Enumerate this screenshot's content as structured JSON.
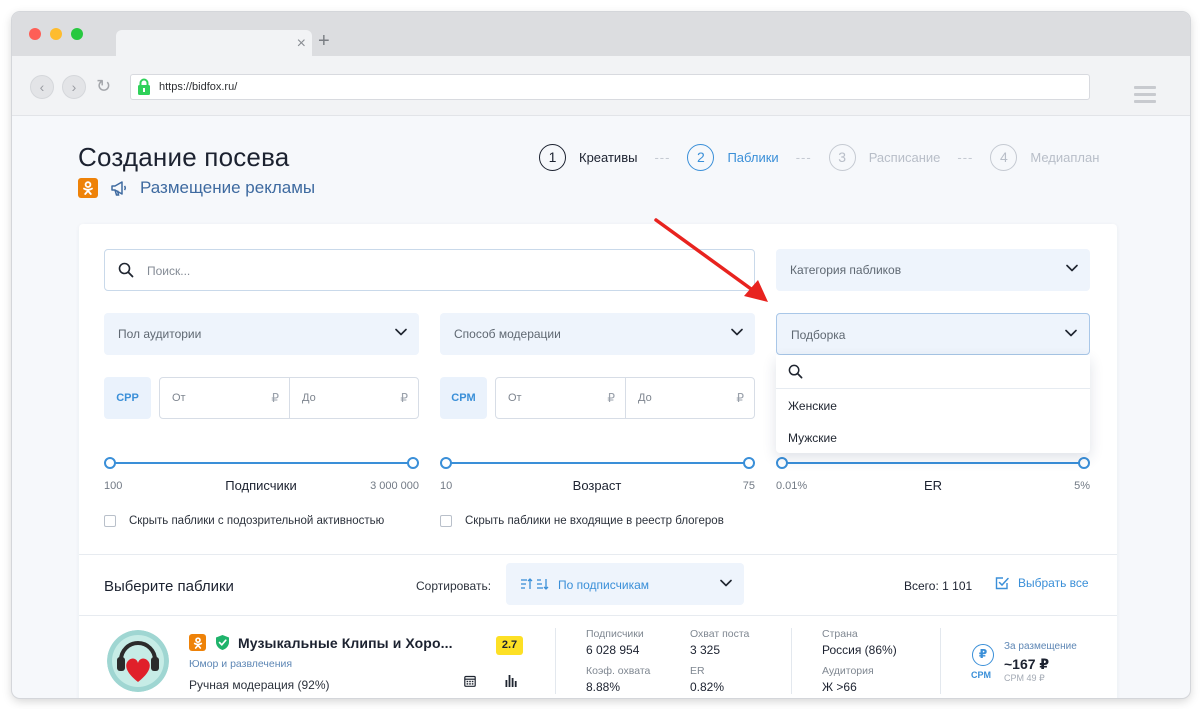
{
  "browser": {
    "url": "https://bidfox.ru/",
    "tab_close": "×",
    "new_tab": "+",
    "back": "‹",
    "forward": "›",
    "reload": "↻"
  },
  "header": {
    "title": "Создание посева",
    "subtitle": "Размещение рекламы"
  },
  "steps": [
    {
      "num": "1",
      "label": "Креативы",
      "state": "done"
    },
    {
      "num": "2",
      "label": "Паблики",
      "state": "active"
    },
    {
      "num": "3",
      "label": "Расписание",
      "state": "muted"
    },
    {
      "num": "4",
      "label": "Медиаплан",
      "state": "muted"
    }
  ],
  "step_separator": "---",
  "filters": {
    "search_placeholder": "Поиск...",
    "category": "Категория пабликов",
    "gender": "Пол аудитории",
    "moderation": "Способ модерации",
    "collection": "Подборка",
    "range1": {
      "tag": "CPP",
      "from": "От",
      "to": "До",
      "currency": "₽"
    },
    "range2": {
      "tag": "CPM",
      "from": "От",
      "to": "До",
      "currency": "₽"
    },
    "slider_subscribers": {
      "min": "100",
      "max": "3 000 000",
      "title": "Подписчики"
    },
    "slider_age": {
      "min": "10",
      "max": "75",
      "title": "Возраст"
    },
    "slider_er": {
      "min": "0.01%",
      "max": "5%",
      "title": "ER"
    },
    "check_suspicious": "Скрыть паблики с подозрительной активностью",
    "check_registry": "Скрыть паблики не входящие в реестр блогеров"
  },
  "dropdown": {
    "items": [
      "Женские",
      "Мужские"
    ]
  },
  "list": {
    "title": "Выберите паблики",
    "sort_label": "Сортировать:",
    "sort_value": "По подписчикам",
    "total": "Всего: 1 101",
    "select_all": "Выбрать все"
  },
  "publics": [
    {
      "name": "Музыкальные Клипы и Хоро...",
      "rating": "2.7",
      "category": "Юмор и развлечения",
      "moderation": "Ручная модерация (92%)",
      "subscribers_label": "Подписчики",
      "subscribers": "6 028 954",
      "reach_label": "Охват поста",
      "reach": "3 325",
      "coverage_label": "Коэф. охвата",
      "coverage": "8.88%",
      "er_label": "ER",
      "er": "0.82%",
      "country_label": "Страна",
      "country": "Россия (86%)",
      "audience_label": "Аудитория",
      "audience": "Ж >66",
      "price_label": "За размещение",
      "price": "~167 ₽",
      "price_tag": "CPM",
      "cpm": "CPM 49 ₽"
    }
  ],
  "colors": {
    "accent": "#3a8fd8",
    "ok_orange": "#ee8208",
    "rating_yellow": "#fde025",
    "arrow_red": "#e8231f"
  }
}
